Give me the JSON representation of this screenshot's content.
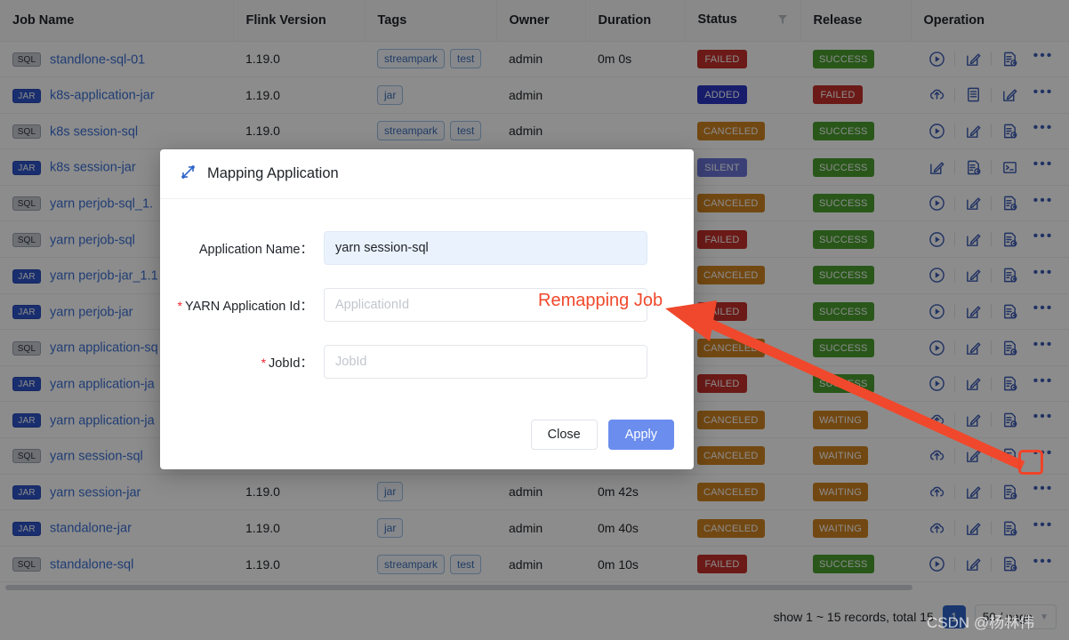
{
  "table": {
    "columns": [
      "Job Name",
      "Flink Version",
      "Tags",
      "Owner",
      "Duration",
      "Status",
      "Release",
      "Operation"
    ],
    "status_filter_icon": "filter-icon",
    "rows": [
      {
        "type": "SQL",
        "name": "standlone-sql-01",
        "flink": "1.19.0",
        "tags": [
          "streampark",
          "test"
        ],
        "owner": "admin",
        "duration": "0m 0s",
        "status": "FAILED",
        "release": "SUCCESS",
        "ops": [
          "play-circle-icon",
          "edit-square-icon",
          "file-log-icon",
          "ellipsis-icon"
        ]
      },
      {
        "type": "JAR",
        "name": "k8s-application-jar",
        "flink": "1.19.0",
        "tags": [
          "jar"
        ],
        "owner": "admin",
        "duration": "",
        "status": "ADDED",
        "release": "FAILED",
        "ops": [
          "cloud-upload-icon",
          "file-text-icon",
          "edit-square-icon",
          "ellipsis-icon"
        ]
      },
      {
        "type": "SQL",
        "name": "k8s session-sql",
        "flink": "1.19.0",
        "tags": [
          "streampark",
          "test"
        ],
        "owner": "admin",
        "duration": "",
        "status": "CANCELED",
        "release": "SUCCESS",
        "ops": [
          "play-circle-icon",
          "edit-square-icon",
          "file-log-icon",
          "ellipsis-icon"
        ]
      },
      {
        "type": "JAR",
        "name": "k8s session-jar",
        "flink": "",
        "tags": [],
        "owner": "",
        "duration": "",
        "status": "SILENT",
        "release": "SUCCESS",
        "ops": [
          "edit-square-icon",
          "file-log-icon",
          "terminal-icon",
          "ellipsis-icon"
        ]
      },
      {
        "type": "SQL",
        "name": "yarn perjob-sql_1.",
        "flink": "",
        "tags": [],
        "owner": "",
        "duration": "",
        "status": "CANCELED",
        "release": "SUCCESS",
        "ops": [
          "play-circle-icon",
          "edit-square-icon",
          "file-log-icon",
          "ellipsis-icon"
        ]
      },
      {
        "type": "SQL",
        "name": "yarn perjob-sql",
        "flink": "",
        "tags": [],
        "owner": "",
        "duration": "",
        "status": "FAILED",
        "release": "SUCCESS",
        "ops": [
          "play-circle-icon",
          "edit-square-icon",
          "file-log-icon",
          "ellipsis-icon"
        ]
      },
      {
        "type": "JAR",
        "name": "yarn perjob-jar_1.1",
        "flink": "",
        "tags": [],
        "owner": "",
        "duration": "",
        "status": "CANCELED",
        "release": "SUCCESS",
        "ops": [
          "play-circle-icon",
          "edit-square-icon",
          "file-log-icon",
          "ellipsis-icon"
        ]
      },
      {
        "type": "JAR",
        "name": "yarn perjob-jar",
        "flink": "",
        "tags": [],
        "owner": "",
        "duration": "",
        "status": "FAILED",
        "release": "SUCCESS",
        "ops": [
          "play-circle-icon",
          "edit-square-icon",
          "file-log-icon",
          "ellipsis-icon"
        ]
      },
      {
        "type": "SQL",
        "name": "yarn application-sq",
        "flink": "",
        "tags": [],
        "owner": "",
        "duration": "",
        "status": "CANCELED",
        "release": "SUCCESS",
        "ops": [
          "play-circle-icon",
          "edit-square-icon",
          "file-log-icon",
          "ellipsis-icon"
        ]
      },
      {
        "type": "JAR",
        "name": "yarn application-ja",
        "flink": "",
        "tags": [],
        "owner": "",
        "duration": "",
        "status": "FAILED",
        "release": "SUCCESS",
        "ops": [
          "play-circle-icon",
          "edit-square-icon",
          "file-log-icon",
          "ellipsis-icon"
        ]
      },
      {
        "type": "JAR",
        "name": "yarn application-ja",
        "flink": "",
        "tags": [],
        "owner": "",
        "duration": "",
        "status": "CANCELED",
        "release": "WAITING",
        "ops": [
          "cloud-upload-icon",
          "edit-square-icon",
          "file-log-icon",
          "ellipsis-icon"
        ]
      },
      {
        "type": "SQL",
        "name": "yarn session-sql",
        "flink": "",
        "tags": [],
        "owner": "",
        "duration": "",
        "status": "CANCELED",
        "release": "WAITING",
        "ops": [
          "cloud-upload-icon",
          "edit-square-icon",
          "file-log-icon",
          "ellipsis-icon"
        ]
      },
      {
        "type": "JAR",
        "name": "yarn session-jar",
        "flink": "1.19.0",
        "tags": [
          "jar"
        ],
        "owner": "admin",
        "duration": "0m 42s",
        "status": "CANCELED",
        "release": "WAITING",
        "ops": [
          "cloud-upload-icon",
          "edit-square-icon",
          "file-log-icon",
          "ellipsis-icon"
        ]
      },
      {
        "type": "JAR",
        "name": "standalone-jar",
        "flink": "1.19.0",
        "tags": [
          "jar"
        ],
        "owner": "admin",
        "duration": "0m 40s",
        "status": "CANCELED",
        "release": "WAITING",
        "ops": [
          "cloud-upload-icon",
          "edit-square-icon",
          "file-log-icon",
          "ellipsis-icon"
        ]
      },
      {
        "type": "SQL",
        "name": "standalone-sql",
        "flink": "1.19.0",
        "tags": [
          "streampark",
          "test"
        ],
        "owner": "admin",
        "duration": "0m 10s",
        "status": "FAILED",
        "release": "SUCCESS",
        "ops": [
          "play-circle-icon",
          "edit-square-icon",
          "file-log-icon",
          "ellipsis-icon"
        ]
      }
    ]
  },
  "pagination": {
    "summary": "show 1 ~ 15 records, total 15",
    "current_page": "1",
    "page_size": "50 / page"
  },
  "modal": {
    "icon": "mapping-arrows-icon",
    "title": "Mapping Application",
    "fields": {
      "app_name": {
        "label": "Application Name：",
        "value": "yarn session-sql",
        "required": false
      },
      "yarn_app_id": {
        "label": "YARN Application Id：",
        "value": "",
        "placeholder": "ApplicationId",
        "required": true
      },
      "job_id": {
        "label": "JobId：",
        "value": "",
        "placeholder": "JobId",
        "required": true
      }
    },
    "buttons": {
      "close": "Close",
      "apply": "Apply"
    }
  },
  "annotation": {
    "label": "Remapping Job",
    "color": "#f0482c",
    "arrow": "points from the row ellipsis menu to the modal"
  },
  "watermark": "CSDN @杨林伟",
  "colors": {
    "primary": "#2f64c8",
    "apply_button": "#6b8dee",
    "status_failed": "#c4302b",
    "status_added": "#2b36c4",
    "status_canceled": "#d08322",
    "status_silent": "#6a76d8",
    "status_success": "#4a9e2f",
    "status_waiting": "#d08322",
    "annotation": "#f0482c"
  }
}
